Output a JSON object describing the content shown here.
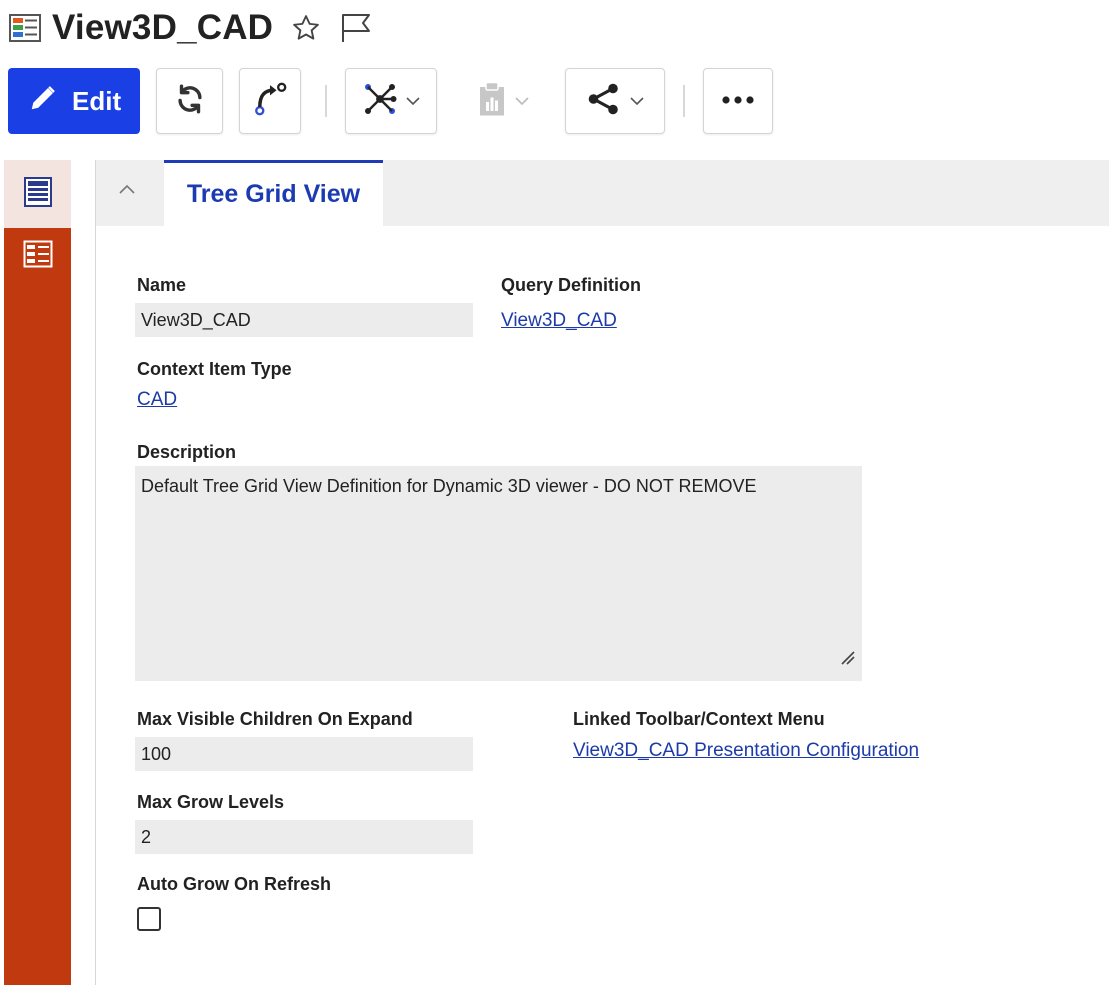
{
  "header": {
    "title": "View3D_CAD",
    "icons": [
      "tree-grid-view-icon",
      "star-icon",
      "flag-icon"
    ]
  },
  "toolbar": {
    "edit_label": "Edit",
    "buttons": [
      "refresh-icon",
      "redirect-icon",
      "network-icon",
      "report-icon",
      "share-icon",
      "more-icon"
    ]
  },
  "sidebar": {
    "items": [
      {
        "icon": "form-view-icon",
        "active": true
      },
      {
        "icon": "tree-grid-view-icon",
        "active": false
      }
    ]
  },
  "tabs": [
    {
      "label": "Tree Grid View",
      "active": true
    }
  ],
  "form": {
    "name": {
      "label": "Name",
      "value": "View3D_CAD"
    },
    "query_definition": {
      "label": "Query Definition",
      "value": "View3D_CAD"
    },
    "context_item_type": {
      "label": "Context Item Type",
      "value": "CAD"
    },
    "description": {
      "label": "Description",
      "value": "Default Tree Grid View Definition for Dynamic 3D viewer - DO NOT REMOVE"
    },
    "max_visible_children": {
      "label": "Max Visible Children On Expand",
      "value": "100"
    },
    "linked_toolbar": {
      "label": "Linked Toolbar/Context Menu",
      "value": "View3D_CAD Presentation Configuration"
    },
    "max_grow_levels": {
      "label": "Max Grow Levels",
      "value": "2"
    },
    "auto_grow": {
      "label": "Auto Grow On Refresh",
      "checked": false
    }
  },
  "colors": {
    "accent": "#1a3fe4",
    "sidebar": "#c0390f",
    "tab_text": "#1c3bb1",
    "link": "#1c3aa8",
    "field_bg": "#ececec"
  }
}
